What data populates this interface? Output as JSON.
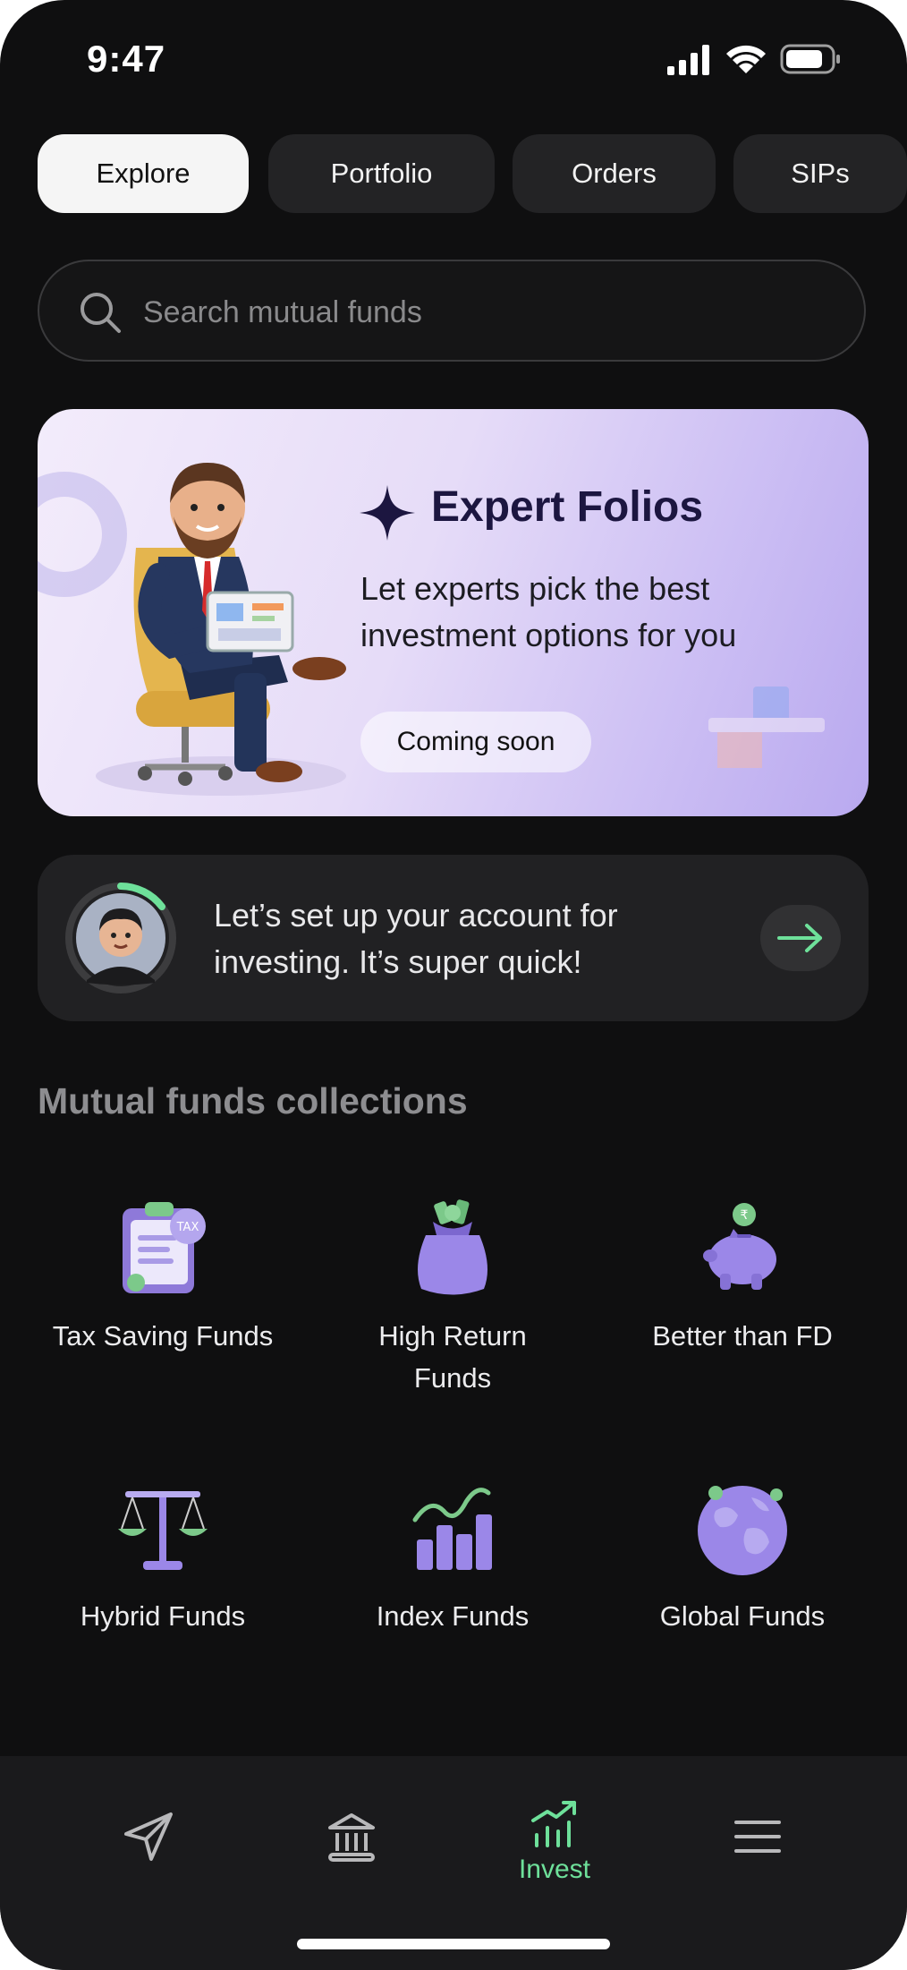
{
  "status_bar": {
    "time": "9:47"
  },
  "tabs": [
    {
      "label": "Explore",
      "active": true
    },
    {
      "label": "Portfolio",
      "active": false
    },
    {
      "label": "Orders",
      "active": false
    },
    {
      "label": "SIPs",
      "active": false
    }
  ],
  "search": {
    "placeholder": "Search mutual funds",
    "value": ""
  },
  "banner": {
    "title": "Expert Folios",
    "text": "Let experts pick the best investment options for you",
    "button_label": "Coming soon"
  },
  "setup_card": {
    "text": "Let’s set up your account for investing. It’s super quick!",
    "progress": 0.15
  },
  "collections": {
    "title": "Mutual funds collections",
    "items": [
      {
        "label": "Tax Saving Funds",
        "icon": "tax-clipboard-icon"
      },
      {
        "label": "High Return Funds",
        "icon": "money-bag-icon"
      },
      {
        "label": "Better than FD",
        "icon": "piggy-bank-icon"
      },
      {
        "label": "Hybrid Funds",
        "icon": "balance-scale-icon"
      },
      {
        "label": "Index Funds",
        "icon": "bar-chart-icon"
      },
      {
        "label": "Global Funds",
        "icon": "globe-icon"
      }
    ]
  },
  "bottom_nav": {
    "items": [
      {
        "icon": "send-icon",
        "label": "",
        "active": false
      },
      {
        "icon": "bank-icon",
        "label": "",
        "active": false
      },
      {
        "icon": "invest-chart-icon",
        "label": "Invest",
        "active": true
      },
      {
        "icon": "menu-icon",
        "label": "",
        "active": false
      }
    ]
  },
  "colors": {
    "accent": "#6ee09a",
    "background": "#0f0f10",
    "card": "#212123",
    "purple": "#9b87e8"
  }
}
